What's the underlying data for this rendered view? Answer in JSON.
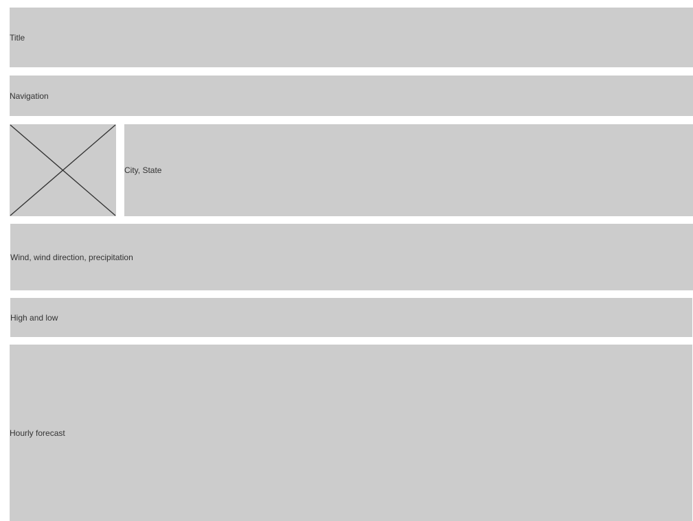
{
  "title": {
    "label": "Title"
  },
  "navigation": {
    "label": "Navigation"
  },
  "location": {
    "image_icon": "image-placeholder-icon",
    "label": "City, State"
  },
  "conditions": {
    "label": "Wind, wind direction, precipitation"
  },
  "temperature": {
    "label": "High and low"
  },
  "forecast": {
    "label": "Hourly forecast"
  },
  "colors": {
    "block_fill": "#cccccc",
    "text": "#333333",
    "placeholder_stroke": "#333333",
    "background": "#ffffff"
  }
}
